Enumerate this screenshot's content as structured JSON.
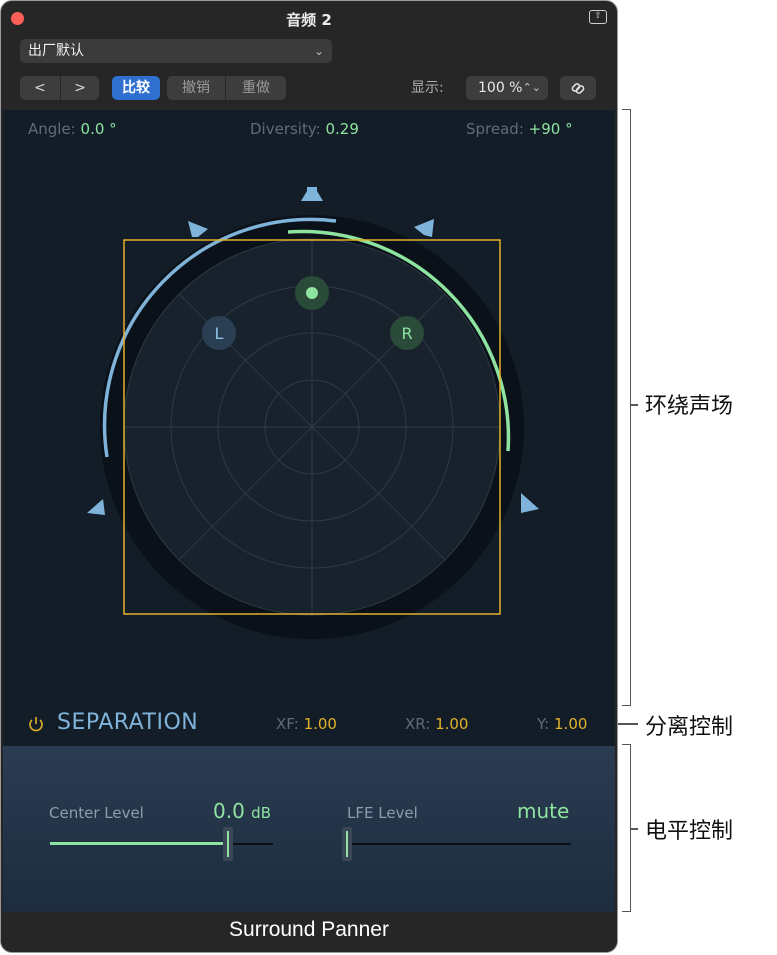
{
  "window": {
    "title": "音频 2"
  },
  "preset": {
    "value": "出厂默认"
  },
  "toolbar": {
    "back": "<",
    "forward": ">",
    "compare": "比较",
    "undo": "撤销",
    "redo": "重做",
    "display_label": "显示:",
    "zoom": "100 %"
  },
  "params": {
    "angle": {
      "label": "Angle:",
      "value": "0.0 °"
    },
    "diversity": {
      "label": "Diversity:",
      "value": "0.29"
    },
    "spread": {
      "label": "Spread:",
      "value": "+90 °"
    }
  },
  "panner": {
    "left_label": "L",
    "right_label": "R"
  },
  "separation": {
    "title": "SEPARATION",
    "xf": {
      "label": "XF:",
      "value": "1.00"
    },
    "xr": {
      "label": "XR:",
      "value": "1.00"
    },
    "y": {
      "label": "Y:",
      "value": "1.00"
    }
  },
  "levels": {
    "center": {
      "label": "Center Level",
      "value": "0.0",
      "unit": "dB",
      "fraction": 0.8
    },
    "lfe": {
      "label": "LFE Level",
      "value": "mute",
      "fraction": 0.0
    }
  },
  "footer": {
    "caption": "Surround Panner"
  },
  "callouts": {
    "surround": "环绕声场",
    "separation": "分离控制",
    "level": "电平控制"
  },
  "colors": {
    "accent_green": "#8ee3a0",
    "accent_blue": "#7fb3d9",
    "accent_yellow": "#e3b22a",
    "compare_blue": "#2f6fcf"
  }
}
